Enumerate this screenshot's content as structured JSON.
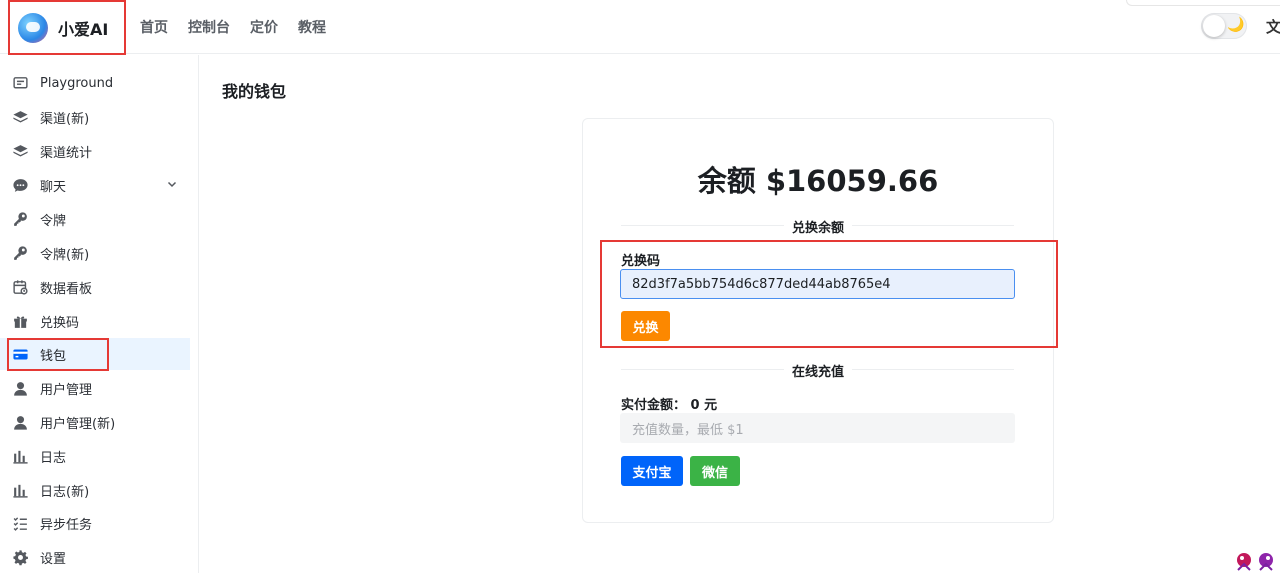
{
  "brand": {
    "name": "小爱AI"
  },
  "topnav": [
    "首页",
    "控制台",
    "定价",
    "教程"
  ],
  "topbar": {
    "theme_moon": "🌙",
    "lang_glyph": "文"
  },
  "sidebar": {
    "items": [
      {
        "label": "Playground",
        "icon": "message-square-icon"
      },
      {
        "label": "渠道(新)",
        "icon": "layers-icon"
      },
      {
        "label": "渠道统计",
        "icon": "layers-icon"
      },
      {
        "label": "聊天",
        "icon": "chat-bubble-icon"
      },
      {
        "label": "令牌",
        "icon": "key-icon"
      },
      {
        "label": "令牌(新)",
        "icon": "key-icon"
      },
      {
        "label": "数据看板",
        "icon": "calendar-clock-icon"
      },
      {
        "label": "兑换码",
        "icon": "gift-icon"
      },
      {
        "label": "钱包",
        "icon": "credit-card-icon"
      },
      {
        "label": "用户管理",
        "icon": "user-icon"
      },
      {
        "label": "用户管理(新)",
        "icon": "user-icon"
      },
      {
        "label": "日志",
        "icon": "bar-chart-icon"
      },
      {
        "label": "日志(新)",
        "icon": "bar-chart-icon"
      },
      {
        "label": "异步任务",
        "icon": "checklist-icon"
      },
      {
        "label": "设置",
        "icon": "gear-icon"
      }
    ],
    "active": "钱包"
  },
  "main": {
    "title": "我的钱包",
    "balance": "余额 $16059.66",
    "redeem_section_title": "兑换余额",
    "redeem_code_label": "兑换码",
    "redeem_code_value": "82d3f7a5bb754d6c877ded44ab8765e4",
    "redeem_button": "兑换",
    "topup_section_title": "在线充值",
    "pay_amount_text": "实付金额： 0 元",
    "topup_placeholder": "充值数量，最低 $1",
    "alipay_button": "支付宝",
    "wechat_button": "微信"
  },
  "colors": {
    "highlight_box": "#e53935",
    "redeem_button": "#fc8800",
    "alipay_button": "#0064fa",
    "wechat_button": "#3bb346",
    "active_sidebar_bg": "#eaf4ff",
    "wallet_icon": "#0064fa"
  }
}
